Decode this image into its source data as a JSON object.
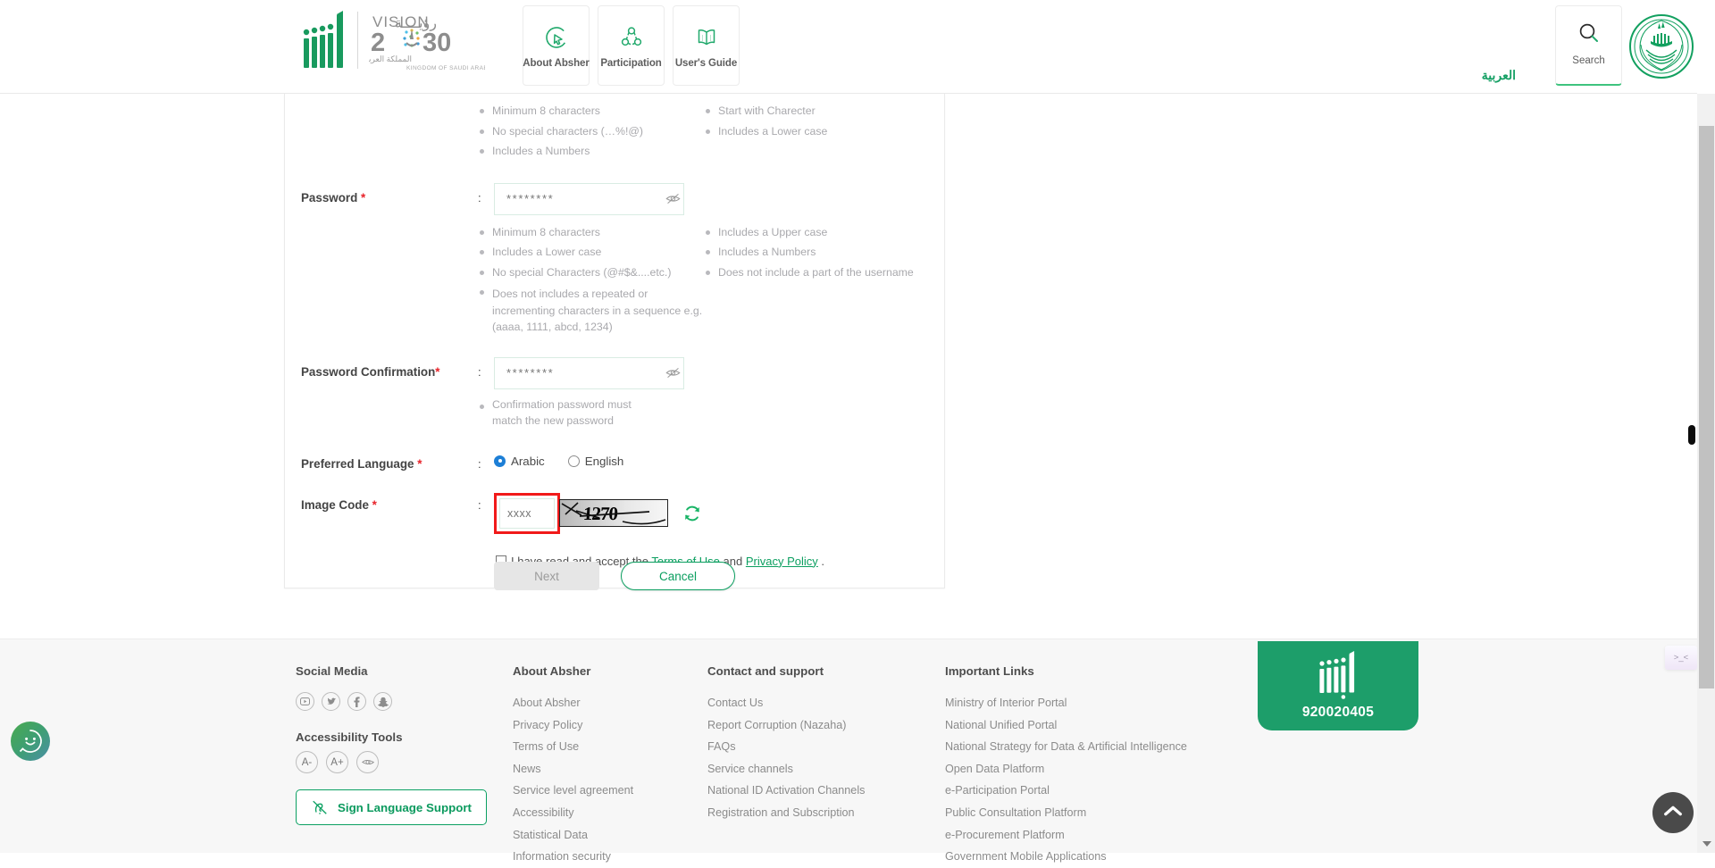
{
  "header": {
    "logo_alt": "Absher",
    "vision_line1": "VISION",
    "vision_arabic": "رؤيــــة",
    "vision_year": "2030",
    "vision_sub_ar": "المملكة العربية السعودية",
    "vision_sub_en": "KINGDOM OF SAUDI ARABIA",
    "nav_tiles": [
      {
        "label": "About Absher",
        "icon": "about-absher-icon"
      },
      {
        "label": "Participation",
        "icon": "participation-icon"
      },
      {
        "label": "User's Guide",
        "icon": "users-guide-icon"
      }
    ],
    "language_link": "العربية",
    "search_label": "Search",
    "seal_alt": "Ministry of Interior Seal"
  },
  "form": {
    "top_hints": {
      "left": [
        "Minimum 8 characters",
        "No special characters (…%!@)",
        "Includes a Numbers"
      ],
      "right": [
        "Start with Charecter",
        "Includes a Lower case"
      ]
    },
    "password": {
      "label": "Password",
      "required_mark": "*",
      "colon": ":",
      "value": "********",
      "placeholder": "",
      "toggle_icon": "eye-off-icon",
      "hints_left": [
        "Minimum 8 characters",
        "Includes a Lower case",
        "No special Characters (@#$&....etc.)",
        "Does not includes a repeated or incrementing characters in a sequence e.g. (aaaa, 1111, abcd, 1234)"
      ],
      "hints_right": [
        "Includes a Upper case",
        "Includes a Numbers",
        "Does not include a part of the username"
      ]
    },
    "password_confirmation": {
      "label": "Password Confirmation",
      "required_mark": "*",
      "colon": ":",
      "value": "********",
      "toggle_icon": "eye-off-icon",
      "hint": "Confirmation password must match the new password"
    },
    "preferred_language": {
      "label": "Preferred Language",
      "required_mark": "*",
      "colon": ":",
      "options": [
        {
          "label": "Arabic",
          "selected": true
        },
        {
          "label": "English",
          "selected": false
        }
      ]
    },
    "image_code": {
      "label": "Image Code",
      "required_mark": "*",
      "colon": ":",
      "value": "",
      "placeholder": "xxxx",
      "captcha_text": "1270",
      "refresh_icon": "refresh-icon",
      "highlighted": true
    },
    "terms": {
      "checked": false,
      "text_before": "I have read and accept the",
      "link1": "Terms of Use",
      "text_middle": "and",
      "link2": "Privacy Policy",
      "text_after": "."
    },
    "buttons": {
      "next": "Next",
      "cancel": "Cancel"
    }
  },
  "footer": {
    "social": {
      "heading": "Social Media",
      "icons": [
        "youtube-icon",
        "twitter-icon",
        "facebook-icon",
        "snapchat-icon"
      ]
    },
    "accessibility": {
      "heading": "Accessibility Tools",
      "buttons": [
        "A-",
        "A+",
        "contrast-eye-icon"
      ],
      "sign_language": "Sign Language Support",
      "sign_icon": "sign-language-icon"
    },
    "about": {
      "heading": "About Absher",
      "links": [
        "About Absher",
        "Privacy Policy",
        "Terms of Use",
        "News",
        "Service level agreement",
        "Accessibility",
        "Statistical Data",
        "Information security"
      ]
    },
    "contact": {
      "heading": "Contact and support",
      "links": [
        "Contact Us",
        "Report Corruption (Nazaha)",
        "FAQs",
        "Service channels",
        "National ID Activation Channels",
        "Registration and Subscription"
      ]
    },
    "important": {
      "heading": "Important Links",
      "links": [
        "Ministry of Interior Portal",
        "National Unified Portal",
        "National Strategy for Data & Artificial Intelligence",
        "Open Data Platform",
        "e-Participation Portal",
        "Public Consultation Platform",
        "e-Procurement Platform",
        "Government Mobile Applications"
      ]
    },
    "phone": {
      "number": "920020405",
      "logo": "absher-white-logo"
    }
  },
  "overlays": {
    "accessibility_widget": "accessibility-smiley-icon",
    "kaomoji": ">_<",
    "back_to_top": "chevron-up-icon"
  },
  "colors": {
    "brand_green": "#0a9e5f",
    "accent_green": "#1d9e6a",
    "required_red": "#e8232a",
    "highlight_red": "#f11a1a",
    "muted_text": "#a9a9ad"
  }
}
